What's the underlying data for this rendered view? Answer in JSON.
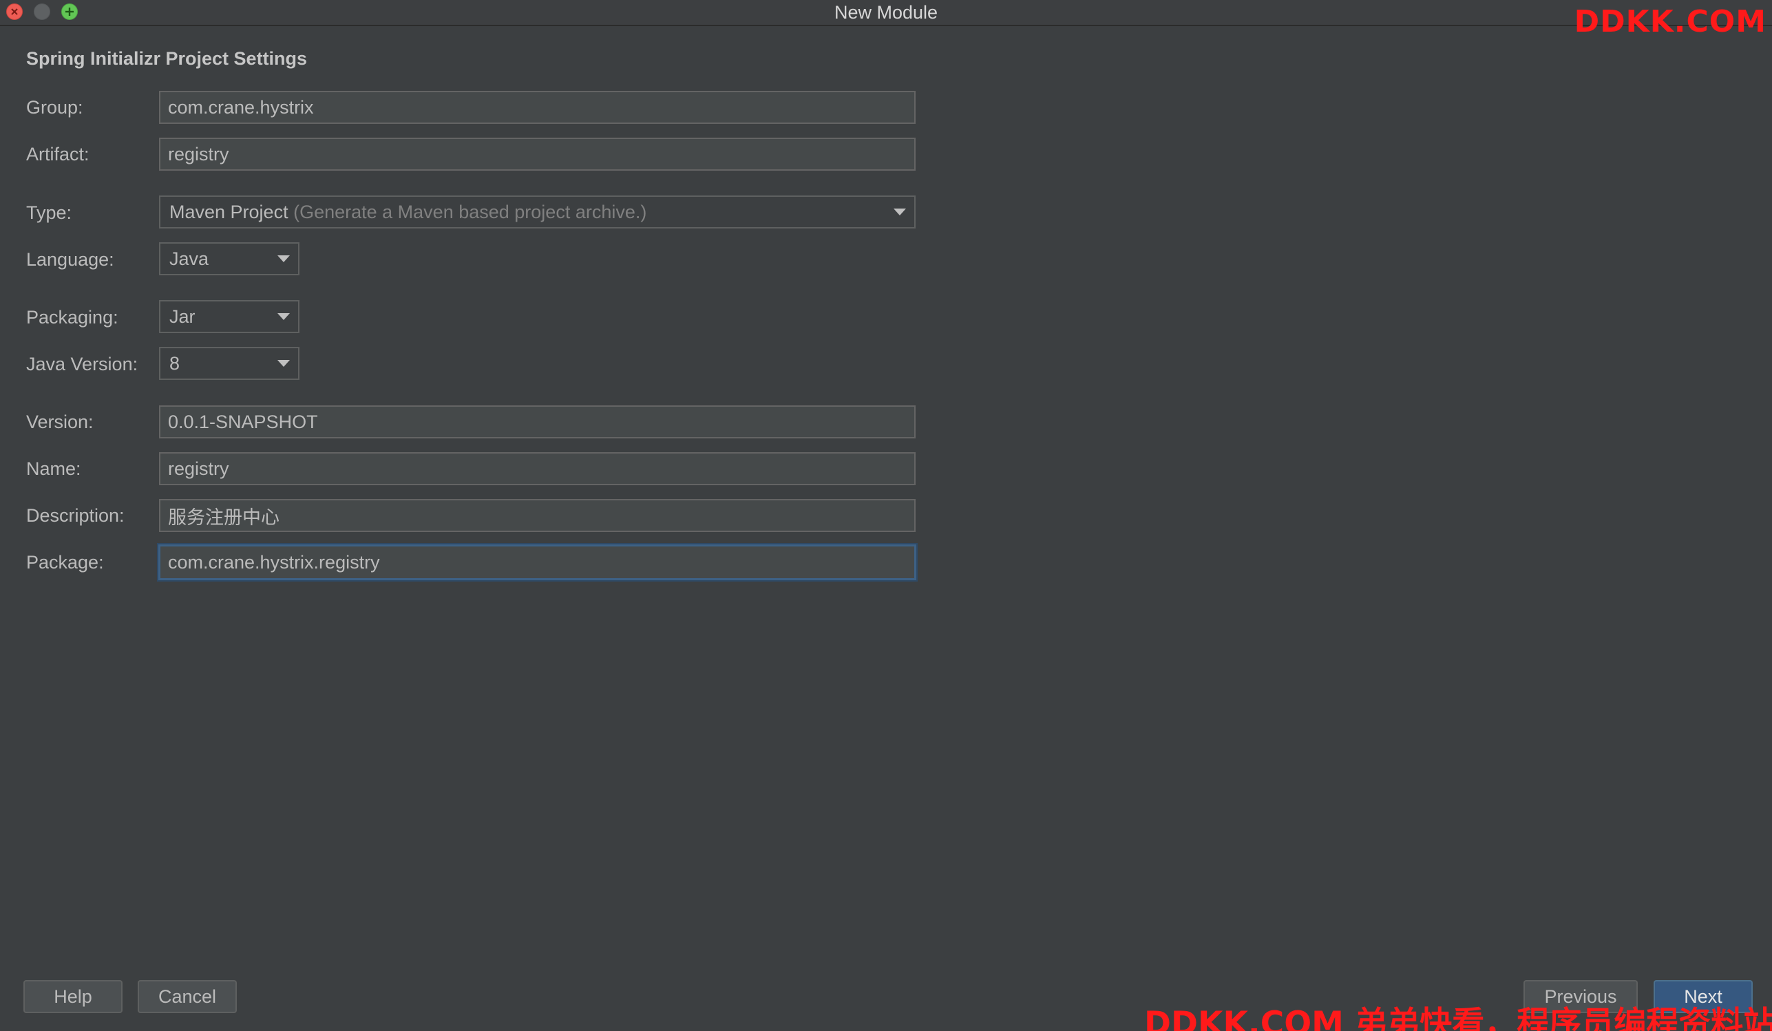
{
  "window": {
    "title": "New Module"
  },
  "watermark": {
    "top": "DDKK.COM",
    "bottom": "DDKK.COM 弟弟快看，程序员编程资料站"
  },
  "section_title": "Spring Initializr Project Settings",
  "form": {
    "group": {
      "label": "Group:",
      "value": "com.crane.hystrix"
    },
    "artifact": {
      "label": "Artifact:",
      "value": "registry"
    },
    "type": {
      "label": "Type:",
      "value": "Maven Project",
      "hint": "(Generate a Maven based project archive.)"
    },
    "language": {
      "label": "Language:",
      "value": "Java"
    },
    "packaging": {
      "label": "Packaging:",
      "value": "Jar"
    },
    "java_version": {
      "label": "Java Version:",
      "value": "8"
    },
    "version": {
      "label": "Version:",
      "value": "0.0.1-SNAPSHOT"
    },
    "name": {
      "label": "Name:",
      "value": "registry"
    },
    "description": {
      "label": "Description:",
      "value": "服务注册中心"
    },
    "package": {
      "label": "Package:",
      "value": "com.crane.hystrix.registry"
    }
  },
  "buttons": {
    "help": "Help",
    "cancel": "Cancel",
    "previous": "Previous",
    "next": "Next"
  },
  "colors": {
    "background": "#3c3f41",
    "field_bg": "#45494a",
    "focus_border": "#3d6185",
    "default_button": "#365880",
    "watermark": "#ff1a1a"
  }
}
